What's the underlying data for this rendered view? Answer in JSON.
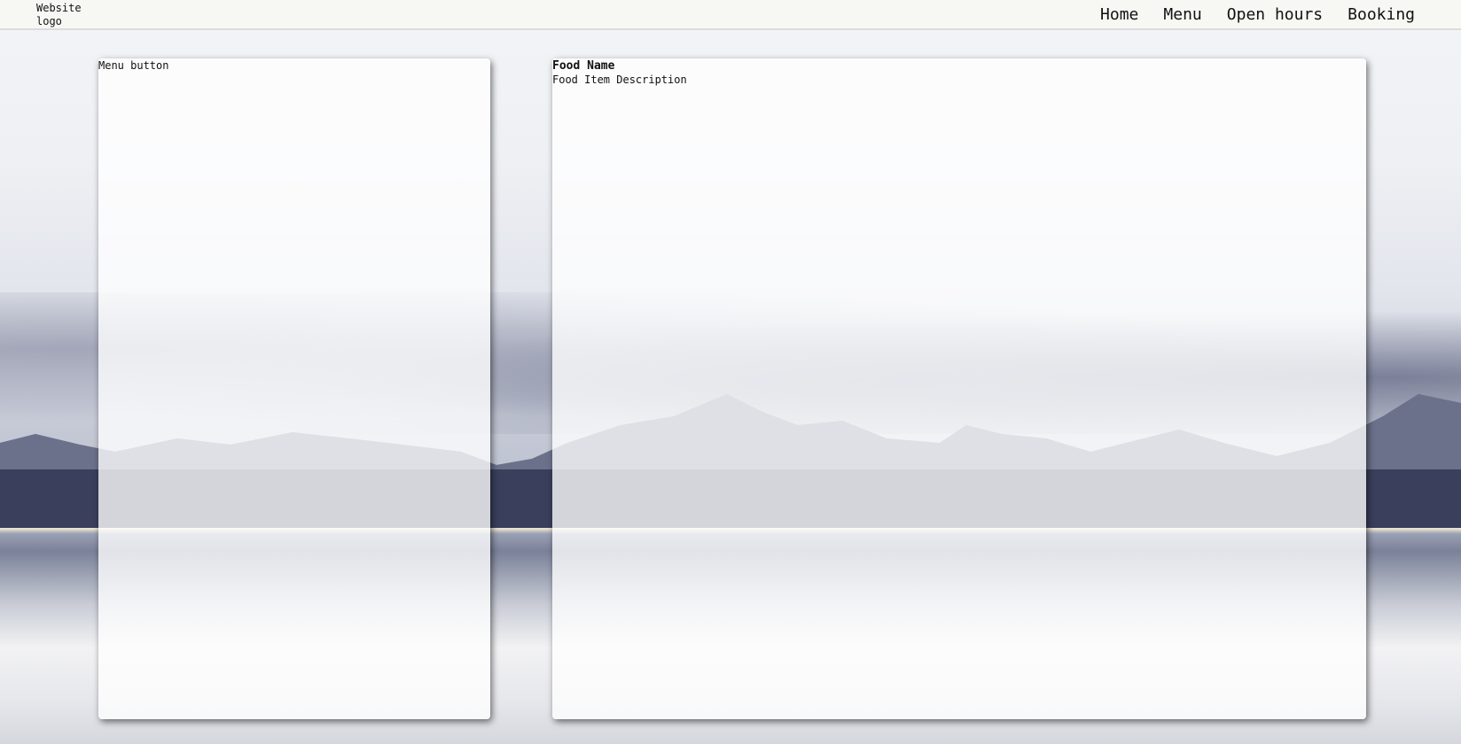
{
  "header": {
    "logo_text": "Website logo",
    "nav": [
      {
        "label": "Home"
      },
      {
        "label": "Menu"
      },
      {
        "label": "Open hours"
      },
      {
        "label": "Booking"
      }
    ]
  },
  "left_panel": {
    "menu_button_label": "Menu button"
  },
  "right_panel": {
    "food_name": "Food Name",
    "food_description": "Food Item Description"
  },
  "colors": {
    "header_bg": "#f7f7f4",
    "panel_bg": "#ffffff",
    "text": "#111111"
  }
}
